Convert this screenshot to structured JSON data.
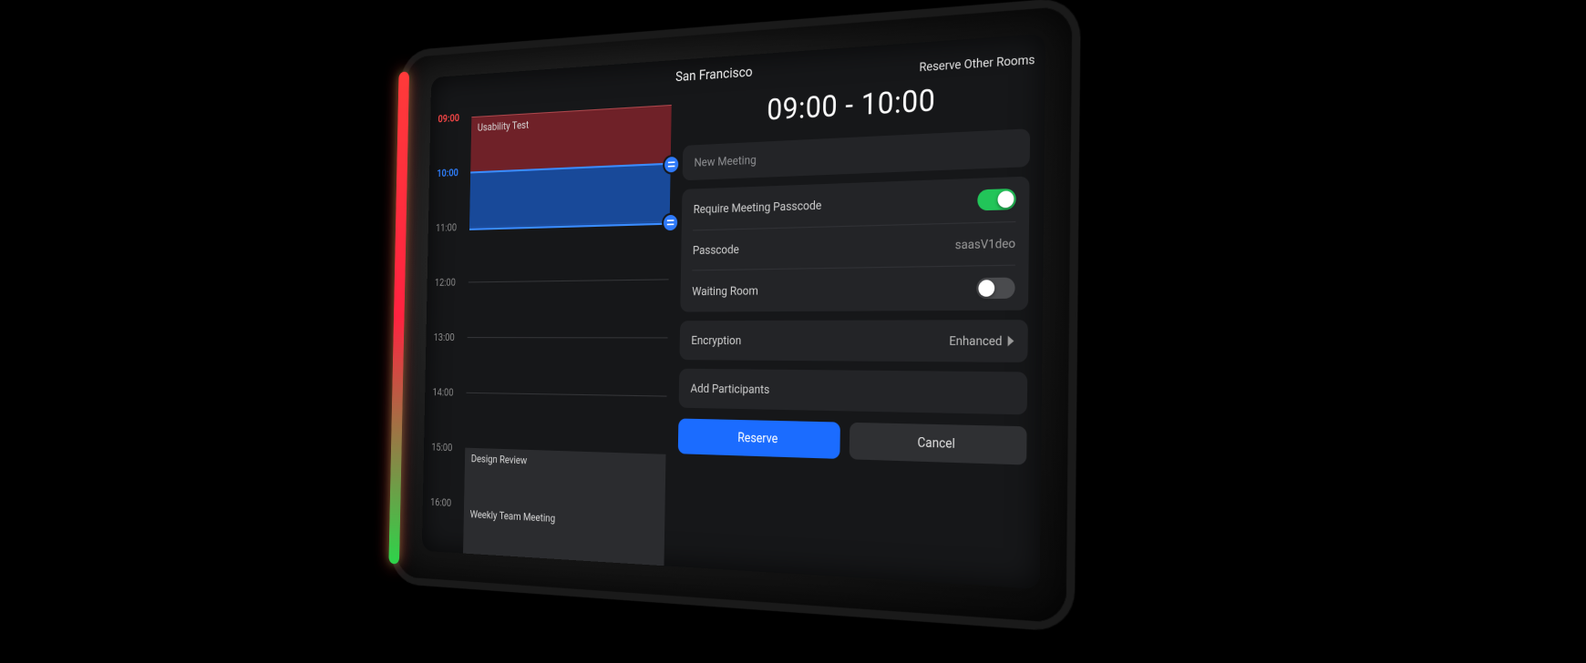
{
  "header": {
    "room_name": "San Francisco",
    "reserve_other_label": "Reserve Other Rooms"
  },
  "timeline": {
    "hours": [
      "09:00",
      "10:00",
      "11:00",
      "12:00",
      "13:00",
      "14:00",
      "15:00",
      "16:00"
    ],
    "current_hour": "09:00",
    "selection_hour": "10:00",
    "events": [
      {
        "title": "Usability Test",
        "start_index": 0,
        "span": 1,
        "kind": "busy"
      },
      {
        "title": "Design Review",
        "start_index": 6,
        "span": 1,
        "kind": "other"
      },
      {
        "title": "Weekly Team Meeting",
        "start_index": 7,
        "span": 1,
        "kind": "other"
      }
    ],
    "selection": {
      "start_index": 1,
      "end_index": 2
    }
  },
  "reservation": {
    "time_range": "09:00 - 10:00",
    "meeting_name_placeholder": "New Meeting",
    "require_passcode_label": "Require Meeting Passcode",
    "require_passcode_on": true,
    "passcode_label": "Passcode",
    "passcode_value": "saasV1deo",
    "waiting_room_label": "Waiting Room",
    "waiting_room_on": false,
    "encryption_label": "Encryption",
    "encryption_value": "Enhanced",
    "add_participants_label": "Add Participants",
    "reserve_button": "Reserve",
    "cancel_button": "Cancel"
  },
  "colors": {
    "accent_blue": "#1b6cff",
    "busy_red": "#89242d",
    "toggle_green": "#22c559",
    "led_red": "#ff3a3a",
    "led_green": "#2dd44a"
  }
}
